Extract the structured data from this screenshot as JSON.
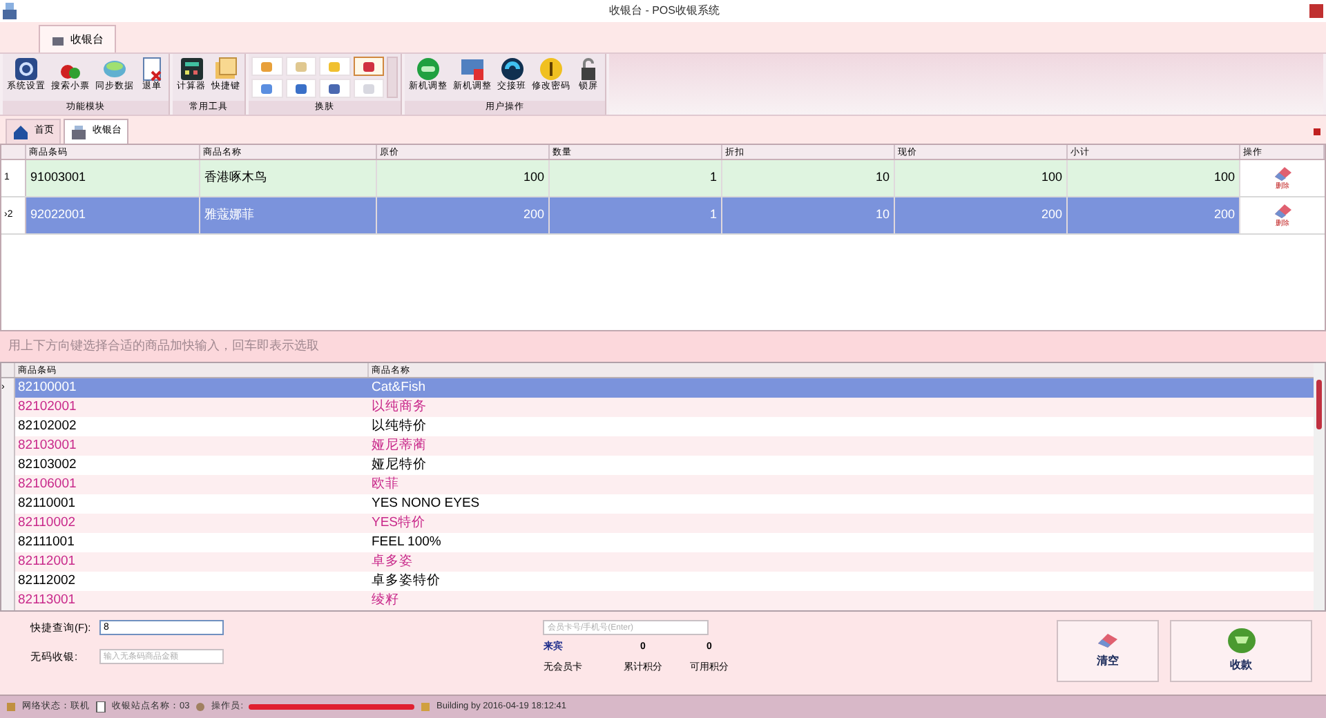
{
  "window": {
    "title": "收银台 - POS收银系统"
  },
  "ribbon_tabs": [
    {
      "label": "收银台",
      "selected": true
    }
  ],
  "ribbon_groups": [
    {
      "title": "功能模块",
      "buttons": [
        "系统设置",
        "搜索小票",
        "同步数据",
        "退单"
      ]
    },
    {
      "title": "常用工具",
      "buttons": [
        "计算器",
        "快捷键"
      ]
    },
    {
      "title": "换肤",
      "kind": "skins",
      "skins": [
        {
          "color": "#e8a03a",
          "selected": false
        },
        {
          "color": "#e0c890",
          "selected": false
        },
        {
          "color": "#f0c030",
          "selected": false
        },
        {
          "color": "#d03040",
          "selected": true
        },
        {
          "color": "#5a8ee0",
          "selected": false
        },
        {
          "color": "#3a70c8",
          "selected": false
        },
        {
          "color": "#4a68b0",
          "selected": false
        },
        {
          "color": "#d8d8e0",
          "selected": false
        }
      ]
    },
    {
      "title": "用户操作",
      "buttons": [
        "新机调整",
        "新机调整",
        "交接班",
        "修改密码",
        "锁屏"
      ]
    }
  ],
  "doc_tabs": [
    {
      "label": "首页",
      "selected": false
    },
    {
      "label": "收银台",
      "selected": true
    }
  ],
  "cart": {
    "pointer": "›",
    "columns": [
      "商品条码",
      "商品名称",
      "原价",
      "数量",
      "折扣",
      "现价",
      "小计",
      "操作"
    ],
    "rows": [
      {
        "index": "1",
        "cells": [
          "91003001",
          "香港啄木鸟",
          "100",
          "1",
          "10",
          "100",
          "100"
        ],
        "action": "删除",
        "selected": false
      },
      {
        "index": "2",
        "cells": [
          "92022001",
          "雅蔻娜菲",
          "200",
          "1",
          "10",
          "200",
          "200"
        ],
        "action": "删除",
        "selected": true
      }
    ]
  },
  "hint": "用上下方向键选择合适的商品加快输入，回车即表示选取",
  "products": {
    "pointer": "›",
    "columns": [
      "商品条码",
      "商品名称"
    ],
    "rows": [
      {
        "code": "82100001",
        "name": "Cat&Fish",
        "selected": true,
        "marked": false
      },
      {
        "code": "82102001",
        "name": "以纯商务",
        "selected": false,
        "marked": true
      },
      {
        "code": "82102002",
        "name": "以纯特价",
        "selected": false,
        "marked": false
      },
      {
        "code": "82103001",
        "name": "娅尼蒂蔺",
        "selected": false,
        "marked": true
      },
      {
        "code": "82103002",
        "name": "娅尼特价",
        "selected": false,
        "marked": false
      },
      {
        "code": "82106001",
        "name": "欧菲",
        "selected": false,
        "marked": true
      },
      {
        "code": "82110001",
        "name": "YES NONO EYES",
        "selected": false,
        "marked": false
      },
      {
        "code": "82110002",
        "name": "YES特价",
        "selected": false,
        "marked": true
      },
      {
        "code": "82111001",
        "name": "FEEL 100%",
        "selected": false,
        "marked": false
      },
      {
        "code": "82112001",
        "name": "卓多姿",
        "selected": false,
        "marked": true
      },
      {
        "code": "82112002",
        "name": "卓多姿特价",
        "selected": false,
        "marked": false
      },
      {
        "code": "82113001",
        "name": "绫籽",
        "selected": false,
        "marked": true
      }
    ]
  },
  "quick_search": {
    "label": "快捷查询(F):",
    "value": "8"
  },
  "no_code": {
    "label": "无码收银:",
    "placeholder": "输入无条码商品金额"
  },
  "member": {
    "placeholder": "会员卡号/手机号(Enter)",
    "name": "来宾",
    "card": "无会员卡",
    "total_points": "0",
    "total_label": "累计积分",
    "points": "0",
    "points_label": "可用积分"
  },
  "actions": [
    {
      "kind": "clear",
      "label": "清空"
    },
    {
      "kind": "pay",
      "label": "收款"
    }
  ],
  "status_bar": {
    "network": "网络状态：联机",
    "station": "收银站点名称：03",
    "operator": "操作员:",
    "build": "Building by 2016-04-19 18:12:41"
  }
}
